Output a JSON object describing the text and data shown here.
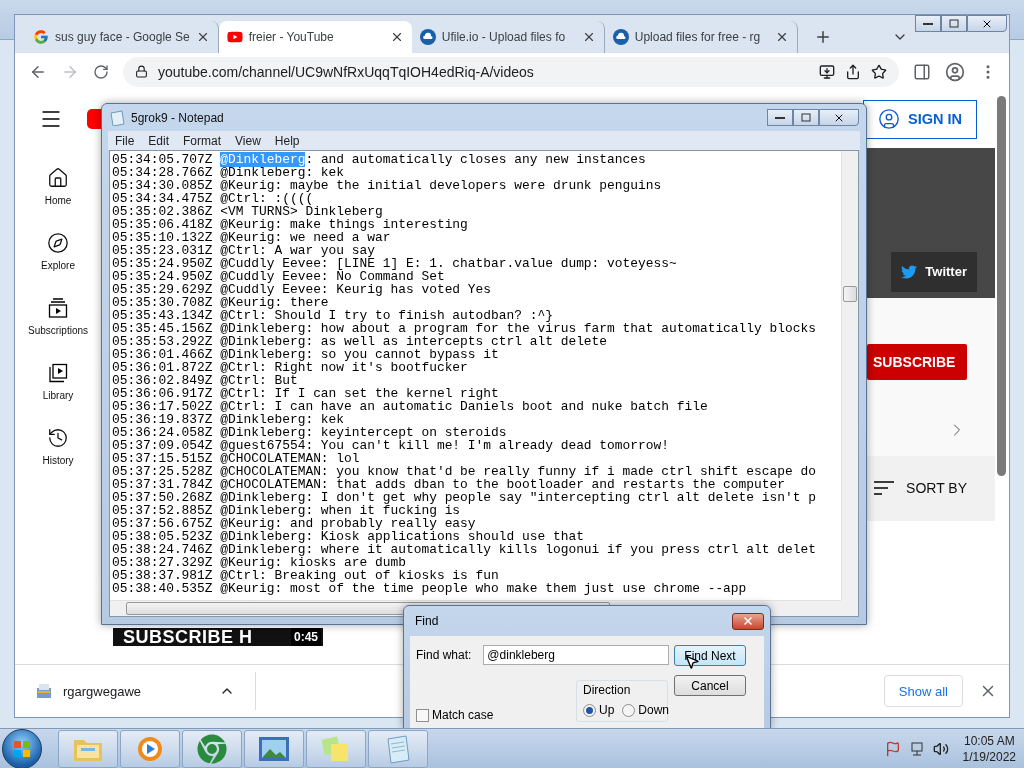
{
  "browser": {
    "tabs": [
      {
        "title": "sus guy face - Google Se",
        "kind": "google",
        "selected": false
      },
      {
        "title": "freier - YouTube",
        "kind": "youtube",
        "selected": true
      },
      {
        "title": "Ufile.io - Upload files fo",
        "kind": "ufile",
        "selected": false
      },
      {
        "title": "Upload files for free - rg",
        "kind": "ufile",
        "selected": false
      }
    ],
    "address": "youtube.com/channel/UC9wNfRxUqqTqIOH4edRiq-A/videos",
    "page": {
      "sidebar": [
        {
          "label": "Home",
          "kind": "home"
        },
        {
          "label": "Explore",
          "kind": "explore"
        },
        {
          "label": "Subscriptions",
          "kind": "subscriptions"
        },
        {
          "label": "Library",
          "kind": "library"
        },
        {
          "label": "History",
          "kind": "history"
        }
      ],
      "sign_in": "SIGN IN",
      "banner_link": "Twitter",
      "subscribe": "SUBSCRIBE",
      "sort": "SORT BY",
      "video": {
        "overlay": "SUBSCRIBE H",
        "duration": "0:45"
      }
    },
    "downloads": {
      "file": "rgargwegawe",
      "show_all": "Show all"
    }
  },
  "notepad": {
    "title": "5grok9 - Notepad",
    "menu": [
      "File",
      "Edit",
      "Format",
      "View",
      "Help"
    ],
    "lines": [
      {
        "before": "05:34:05.707Z ",
        "highlight": "@Dinkleberg",
        "after": ": and automatically closes any new instances"
      },
      {
        "text": "05:34:28.766Z @Dinkleberg: kek"
      },
      {
        "text": "05:34:30.085Z @Keurig: maybe the initial developers were drunk penguins"
      },
      {
        "text": "05:34:34.475Z @Ctrl: :(((("
      },
      {
        "text": "05:35:02.386Z <VM TURNS> Dinkleberg"
      },
      {
        "text": "05:35:06.418Z @Keurig: make things interesting"
      },
      {
        "text": "05:35:10.132Z @Keurig: we need a war"
      },
      {
        "text": "05:35:23.031Z @Ctrl: A war you say"
      },
      {
        "text": "05:35:24.950Z @Cuddly Eevee: [LINE 1] E: 1. chatbar.value dump: voteyess~"
      },
      {
        "text": "05:35:24.950Z @Cuddly Eevee: No Command Set"
      },
      {
        "text": "05:35:29.629Z @Cuddly Eevee: Keurig has voted Yes"
      },
      {
        "text": "05:35:30.708Z @Keurig: there"
      },
      {
        "text": "05:35:43.134Z @Ctrl: Should I try to finish autodban? :^}"
      },
      {
        "text": "05:35:45.156Z @Dinkleberg: how about a program for the virus farm that automatically blocks"
      },
      {
        "text": "05:35:53.292Z @Dinkleberg: as well as intercepts ctrl alt delete"
      },
      {
        "text": "05:36:01.466Z @Dinkleberg: so you cannot bypass it"
      },
      {
        "text": "05:36:01.872Z @Ctrl: Right now it's bootfucker"
      },
      {
        "text": "05:36:02.849Z @Ctrl: But"
      },
      {
        "text": "05:36:06.917Z @Ctrl: If I can set the kernel right"
      },
      {
        "text": "05:36:17.502Z @Ctrl: I can have an automatic Daniels boot and nuke batch file"
      },
      {
        "text": "05:36:19.837Z @Dinkleberg: kek"
      },
      {
        "text": "05:36:24.058Z @Dinkleberg: keyintercept on steroids"
      },
      {
        "text": "05:37:09.054Z @guest67554: You can't kill me! I'm already dead tomorrow!"
      },
      {
        "text": "05:37:15.515Z @CHOCOLATEMAN: lol"
      },
      {
        "text": "05:37:25.528Z @CHOCOLATEMAN: you know that'd be really funny if i made ctrl shift escape do"
      },
      {
        "text": "05:37:31.784Z @CHOCOLATEMAN: that adds dban to the bootloader and restarts the computer"
      },
      {
        "text": "05:37:50.268Z @Dinkleberg: I don't get why people say \"intercepting ctrl alt delete isn't p"
      },
      {
        "text": "05:37:52.885Z @Dinkleberg: when it fucking is"
      },
      {
        "text": "05:37:56.675Z @Keurig: and probably really easy"
      },
      {
        "text": "05:38:05.523Z @Dinkleberg: Kiosk applications should use that"
      },
      {
        "text": "05:38:24.746Z @Dinkleberg: where it automatically kills logonui if you press ctrl alt delet"
      },
      {
        "text": "05:38:27.329Z @Keurig: kiosks are dumb"
      },
      {
        "text": "05:38:37.981Z @Ctrl: Breaking out of kiosks is fun"
      },
      {
        "text": "05:38:40.535Z @Keurig: most of the time people who make them just use chrome --app"
      }
    ]
  },
  "find": {
    "title": "Find",
    "label": "Find what:",
    "value": "@dinkleberg",
    "find_next": "Find Next",
    "cancel": "Cancel",
    "direction": {
      "label": "Direction",
      "options": [
        {
          "label": "Up",
          "selected": true
        },
        {
          "label": "Down",
          "selected": false
        }
      ]
    },
    "match_case": {
      "label": "Match case",
      "checked": false
    }
  },
  "taskbar": {
    "apps": [
      {
        "kind": "explorer"
      },
      {
        "kind": "media"
      },
      {
        "kind": "chrome"
      },
      {
        "kind": "photos"
      },
      {
        "kind": "notes"
      },
      {
        "kind": "notepad"
      }
    ],
    "time": "10:05 AM",
    "date": "1/19/2022"
  }
}
